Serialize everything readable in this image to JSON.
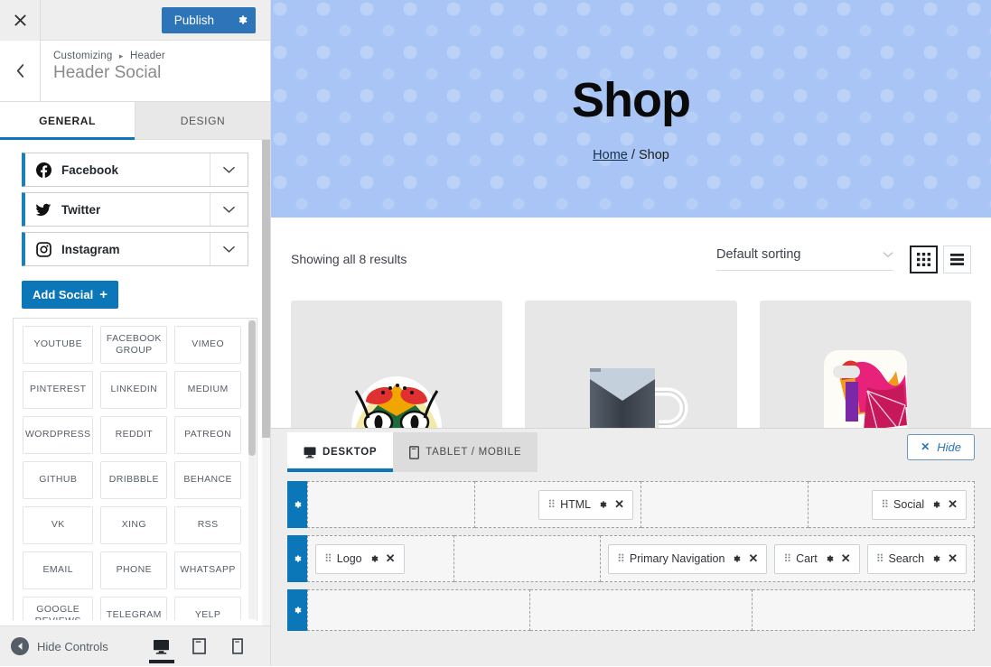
{
  "sidebar": {
    "topbar": {
      "close_label": "✕",
      "publish_label": "Publish",
      "gear_icon": "gear-icon",
      "accent": "#2d74b8"
    },
    "section": {
      "breadcrumb_root": "Customizing",
      "breadcrumb_sep": "▸",
      "breadcrumb_current": "Header",
      "title": "Header Social",
      "back_icon": "chevron-left-icon"
    },
    "tabs": [
      {
        "label": "GENERAL",
        "active": true
      },
      {
        "label": "DESIGN",
        "active": false
      }
    ],
    "social_items": [
      {
        "label": "Facebook",
        "icon": "facebook-icon"
      },
      {
        "label": "Twitter",
        "icon": "twitter-icon"
      },
      {
        "label": "Instagram",
        "icon": "instagram-icon"
      }
    ],
    "add_social": {
      "label": "Add Social",
      "plus": "+"
    },
    "networks": [
      "YOUTUBE",
      "FACEBOOK GROUP",
      "VIMEO",
      "PINTEREST",
      "LINKEDIN",
      "MEDIUM",
      "WORDPRESS",
      "REDDIT",
      "PATREON",
      "GITHUB",
      "DRIBBBLE",
      "BEHANCE",
      "VK",
      "XING",
      "RSS",
      "EMAIL",
      "PHONE",
      "WHATSAPP",
      "GOOGLE REVIEWS",
      "TELEGRAM",
      "YELP"
    ],
    "footer": {
      "hide_controls_label": "Hide Controls",
      "devices": [
        {
          "name": "desktop",
          "active": true
        },
        {
          "name": "tablet",
          "active": false
        },
        {
          "name": "mobile",
          "active": false
        }
      ]
    }
  },
  "preview": {
    "hero": {
      "title": "Shop",
      "breadcrumb_home": "Home",
      "breadcrumb_sep": "/",
      "breadcrumb_current": "Shop",
      "background": "#a9c5f5"
    },
    "shop_bar": {
      "results_text": "Showing all 8 results",
      "sorting_value": "Default sorting",
      "grid_view_active": true,
      "list_view_active": false
    },
    "products": [
      {
        "name": "owl-art-print"
      },
      {
        "name": "dark-mug"
      },
      {
        "name": "colorful-phone-case"
      }
    ]
  },
  "builder": {
    "tabs": [
      {
        "label": "DESKTOP",
        "icon": "desktop-icon",
        "active": true
      },
      {
        "label": "TABLET / MOBILE",
        "icon": "mobile-icon",
        "active": false
      }
    ],
    "hide_button": {
      "x": "✕",
      "label": "Hide"
    },
    "rows": [
      {
        "name": "top-row",
        "zones": [
          {
            "align": "end",
            "items": []
          },
          {
            "align": "end",
            "items": [
              {
                "label": "HTML"
              }
            ]
          },
          {
            "align": "end",
            "items": []
          },
          {
            "align": "end",
            "items": [
              {
                "label": "Social"
              }
            ]
          }
        ]
      },
      {
        "name": "main-row",
        "zones": [
          {
            "align": "start",
            "items": [
              {
                "label": "Logo"
              }
            ]
          },
          {
            "align": "start",
            "items": []
          },
          {
            "align": "start",
            "items": [
              {
                "label": "Primary Navigation"
              },
              {
                "label": "Cart"
              },
              {
                "label": "Search"
              }
            ]
          }
        ]
      },
      {
        "name": "bottom-row",
        "zones": [
          {
            "align": "start",
            "items": []
          },
          {
            "align": "start",
            "items": []
          },
          {
            "align": "start",
            "items": []
          }
        ]
      }
    ],
    "item_icons": {
      "grip": "drag-handle-icon",
      "gear": "gear-icon",
      "close": "close-icon"
    }
  }
}
